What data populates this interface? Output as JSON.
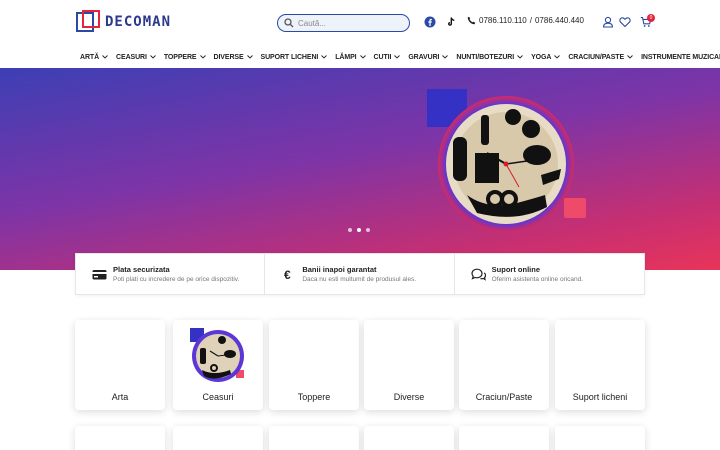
{
  "brand": {
    "name": "DECOMAN",
    "colors": {
      "primary": "#2b4aa6",
      "accent": "#e3243b"
    }
  },
  "search": {
    "placeholder": "Caută..."
  },
  "contact": {
    "phone1": "0786.110.110",
    "separator": "/",
    "phone2": "0786.440.440"
  },
  "cart": {
    "count": "0"
  },
  "nav": [
    "ARTĂ",
    "CEASURI",
    "TOPPERE",
    "DIVERSE",
    "SUPORT LICHENI",
    "LĂMPI",
    "CUTII",
    "GRAVURI",
    "NUNTI/BOTEZURI",
    "YOGA",
    "CRACIUN/PASTE",
    "INSTRUMENTE MUZICALE"
  ],
  "hero": {
    "slides": 3,
    "active_slide": 2
  },
  "features": [
    {
      "icon": "credit-card-icon",
      "title": "Plata securizata",
      "desc": "Poti plati cu incredere de pe orice dispozitiv."
    },
    {
      "icon": "euro-icon",
      "title": "Banii inapoi garantat",
      "desc": "Daca nu esti multumit de produsul ales."
    },
    {
      "icon": "chat-icon",
      "title": "Suport online",
      "desc": "Oferim asistenta online oricand."
    }
  ],
  "categories": [
    "Arta",
    "Ceasuri",
    "Toppere",
    "Diverse",
    "Craciun/Paste",
    "Suport licheni"
  ]
}
